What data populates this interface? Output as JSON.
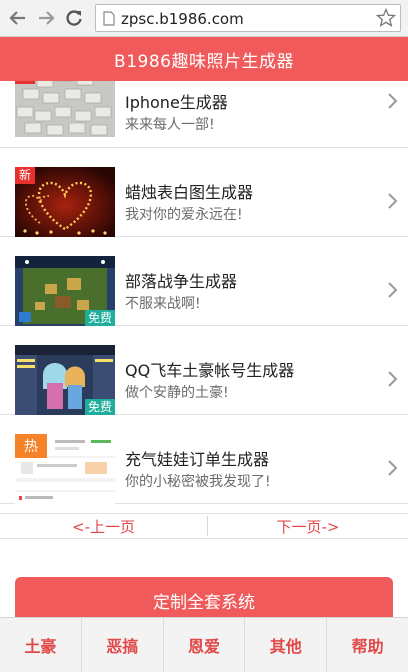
{
  "browser": {
    "url": "zpsc.b1986.com",
    "icons": [
      "back-arrow-icon",
      "forward-arrow-icon",
      "reload-icon",
      "page-icon",
      "bookmark-star-icon"
    ]
  },
  "header": {
    "title": "B1986趣味照片生成器"
  },
  "items": [
    {
      "title": "Iphone生成器",
      "subtitle": "来来每人一部!",
      "badge": "新"
    },
    {
      "title": "蜡烛表白图生成器",
      "subtitle": "我对你的爱永远在!",
      "badge": "新"
    },
    {
      "title": "部落战争生成器",
      "subtitle": "不服来战啊!",
      "badge": "免费"
    },
    {
      "title": "QQ飞车土豪帐号生成器",
      "subtitle": "做个安静的土豪!",
      "badge": "免费"
    },
    {
      "title": "充气娃娃订单生成器",
      "subtitle": "你的小秘密被我发现了!",
      "badge": "热"
    }
  ],
  "pager": {
    "prev": "<-上一页",
    "next": "下一页->"
  },
  "cta": {
    "label": "定制全套系统"
  },
  "tabs": [
    {
      "label": "土豪"
    },
    {
      "label": "恶搞"
    },
    {
      "label": "恩爱"
    },
    {
      "label": "其他"
    },
    {
      "label": "帮助"
    }
  ],
  "colors": {
    "accent": "#f05a5a",
    "link_red": "#e24848",
    "free_badge": "#1fae9c",
    "hot_badge": "#f6822a"
  }
}
